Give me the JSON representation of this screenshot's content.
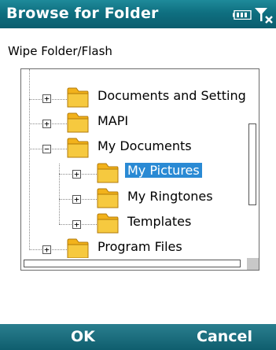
{
  "window": {
    "title": "Browse for Folder"
  },
  "status": {
    "battery_icon": "battery-icon",
    "signal_icon": "signal-off-icon"
  },
  "path_label": "Wipe Folder/Flash",
  "tree": {
    "items": [
      {
        "label": "Documents and Setting",
        "expander": "+",
        "level": 0,
        "selected": false
      },
      {
        "label": "MAPI",
        "expander": "+",
        "level": 0,
        "selected": false
      },
      {
        "label": "My Documents",
        "expander": "−",
        "level": 0,
        "selected": false
      },
      {
        "label": "My Pictures",
        "expander": "+",
        "level": 1,
        "selected": true
      },
      {
        "label": "My Ringtones",
        "expander": "+",
        "level": 1,
        "selected": false
      },
      {
        "label": "Templates",
        "expander": "+",
        "level": 1,
        "selected": false
      },
      {
        "label": "Program Files",
        "expander": "+",
        "level": 0,
        "selected": false
      }
    ]
  },
  "softkeys": {
    "left": "OK",
    "right": "Cancel"
  },
  "colors": {
    "title_bar": "#0f6f80",
    "selection": "#2a8ad4",
    "folder": "#f2b21b"
  }
}
